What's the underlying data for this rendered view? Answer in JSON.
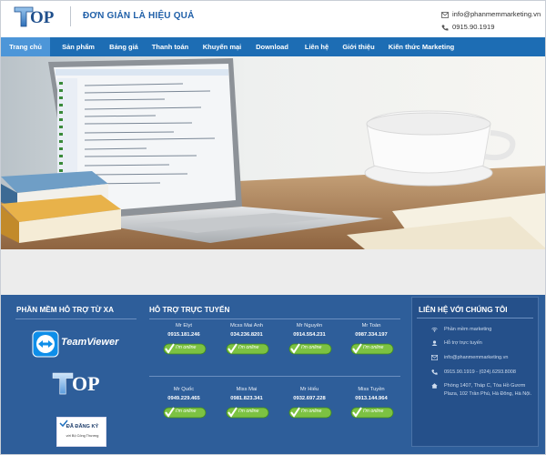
{
  "header": {
    "logo_letters": "OP",
    "slogan": "ĐƠN GIẢN LÀ HIỆU QUẢ",
    "email": "info@phanmemmarketing.vn",
    "phone": "0915.90.1919",
    "email_icon": "mail-icon",
    "phone_icon": "phone-icon"
  },
  "nav": {
    "items": [
      {
        "label": "Trang chủ",
        "active": true
      },
      {
        "label": "Sản phẩm"
      },
      {
        "label": "Bảng giá"
      },
      {
        "label": "Thanh toán"
      },
      {
        "label": "Khuyến mại"
      },
      {
        "label": "Download"
      },
      {
        "label": "Liên hệ"
      },
      {
        "label": "Giới thiệu"
      },
      {
        "label": "Kiến thức Marketing"
      }
    ],
    "bar_color": "#1d6db4",
    "active_color": "#4d96d8"
  },
  "remote": {
    "title": "PHẦN MỀM HỖ TRỢ TỪ XA",
    "teamviewer": "TeamViewer",
    "logo_letters": "OP",
    "badge_main": "ĐÃ ĐĂNG KÝ",
    "badge_sub": "với Bộ Công Thương"
  },
  "support": {
    "title": "HỖ TRỢ TRỰC TUYẾN",
    "online_label": "I'm online",
    "people": [
      {
        "name": "Mr Elyt",
        "phone": "0915.181.246"
      },
      {
        "name": "Mcss Mai Anh",
        "phone": "034.236.8201"
      },
      {
        "name": "Mr Nguyên",
        "phone": "0914.554.231"
      },
      {
        "name": "Mr Toàn",
        "phone": "0987.334.197"
      },
      {
        "name": "Mr Quốc",
        "phone": "0949.229.465"
      },
      {
        "name": "Miss Mai",
        "phone": "0981.823.341"
      },
      {
        "name": "Mr Hiếu",
        "phone": "0932.697.228"
      },
      {
        "name": "Miss Tuyền",
        "phone": "0913.144.964"
      }
    ]
  },
  "contact": {
    "title": "LIÊN HỆ VỚI CHÚNG TÔI",
    "items": [
      {
        "icon": "wifi-icon",
        "text": "Phần mềm marketing"
      },
      {
        "icon": "support-icon",
        "text": "Hỗ trợ trực tuyến"
      },
      {
        "icon": "mail-icon",
        "text": "info@phanmemmarketing.vn"
      },
      {
        "icon": "phone-icon",
        "text": "0915.90.1919 - (024).6293.8008"
      },
      {
        "icon": "home-icon",
        "text": "Phòng 1407, Tháp C, Tòa Hồ Gươm Plaza, 102 Trần Phú, Hà Đông, Hà Nội."
      }
    ]
  }
}
